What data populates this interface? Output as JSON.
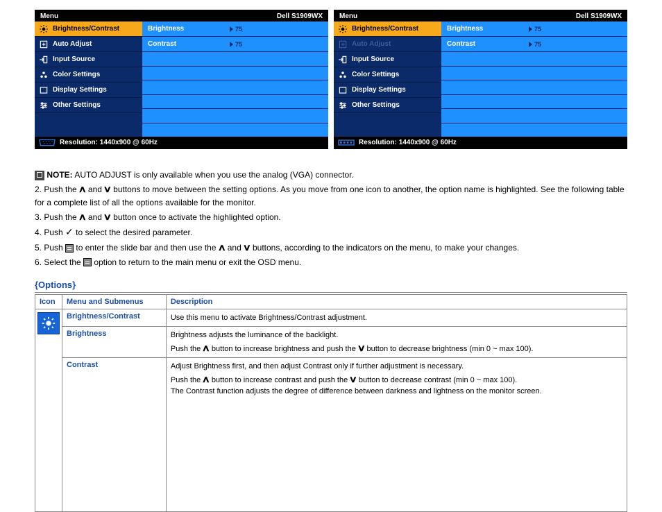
{
  "osd": {
    "menu_title": "Menu",
    "model": "Dell S1909WX",
    "items": [
      {
        "label": "Brightness/Contrast"
      },
      {
        "label": "Auto Adjust"
      },
      {
        "label": "Input Source"
      },
      {
        "label": "Color Settings"
      },
      {
        "label": "Display Settings"
      },
      {
        "label": "Other Settings"
      }
    ],
    "right_rows": [
      {
        "label": "Brightness",
        "value": "75"
      },
      {
        "label": "Contrast",
        "value": "75"
      }
    ],
    "footer_resolution": "Resolution: 1440x900 @ 60Hz"
  },
  "note": {
    "heading": "NOTE:",
    "intro": "AUTO ADJUST is only available when you use the analog (VGA) connector.",
    "step2": "2. Push the",
    "step2_mid": "and",
    "step2_end": "buttons to move between the setting options. As you move from one icon to another, the option name is highlighted. See the following table for a complete list of all the options available for the monitor.",
    "step3": "3. Push the",
    "step3_mid": "and",
    "step3_end": "button once to activate the highlighted option.",
    "step4": "4. Push ",
    "step4_end": " to select the desired parameter.",
    "step5_a": "5. Push",
    "step5_b": "to enter the slide bar and then use the",
    "step5_c": "and",
    "step5_d": "buttons, according to the indicators on the menu, to make your changes.",
    "step6": "6. Select the",
    "step6_end": "option to return to the main menu or exit the OSD menu."
  },
  "options_header": "{Options}",
  "table": {
    "head": {
      "icon": "Icon",
      "menu": "Menu and Submenus",
      "desc": "Description"
    },
    "row1": {
      "menu": "Brightness/Contrast",
      "desc_intro": "Use this menu to activate Brightness/Contrast adjustment.",
      "brightness_label": "Brightness",
      "brightness_intro": "Brightness adjusts the luminance of the backlight.",
      "brightness_line": "Push the      button to increase brightness and push the      button to decrease brightness (min 0 ~ max 100).",
      "contrast_label": "Contrast",
      "contrast_intro": "Adjust Brightness first, and then adjust Contrast only if further adjustment is necessary.",
      "contrast_line": "Push the      button to increase contrast and push the      button to decrease contrast (min 0 ~ max 100).",
      "contrast_note": "The Contrast function adjusts the degree of difference between darkness and lightness on the monitor screen."
    }
  }
}
